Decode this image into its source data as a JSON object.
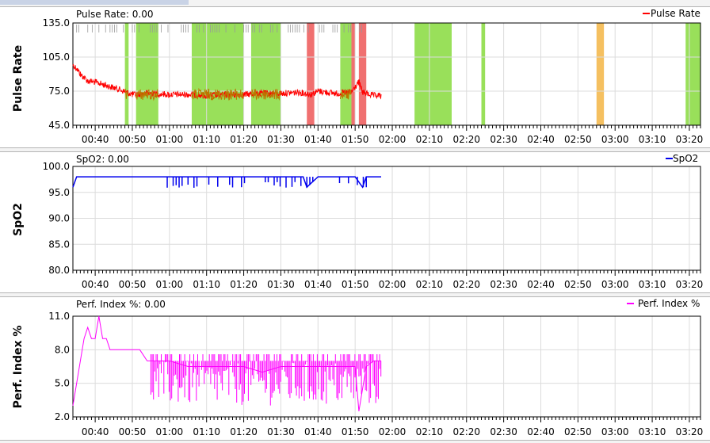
{
  "charts": [
    {
      "id": "pulse",
      "ylabel": "Pulse Rate",
      "title": "Pulse Rate: 0.00",
      "legend": "Pulse Rate",
      "color": "#ff0000",
      "overlap_color": "#bb7700",
      "yticks": [
        "135.0",
        "105.0",
        "75.0",
        "45.0"
      ]
    },
    {
      "id": "spo2",
      "ylabel": "SpO2",
      "title": "SpO2: 0.00",
      "legend": "SpO2",
      "color": "#0000ee",
      "yticks": [
        "100.0",
        "95.0",
        "90.0",
        "85.0",
        "80.0"
      ]
    },
    {
      "id": "perf",
      "ylabel": "Perf. Index %",
      "title": "Perf. Index %: 0.00",
      "legend": "Perf. Index %",
      "color": "#ff00ff",
      "yticks": [
        "11.0",
        "8.0",
        "5.0",
        "2.0"
      ]
    }
  ],
  "xticks": [
    "00:40",
    "00:50",
    "01:00",
    "01:10",
    "01:20",
    "01:30",
    "01:40",
    "01:50",
    "02:00",
    "02:10",
    "02:20",
    "02:30",
    "02:40",
    "02:50",
    "03:00",
    "03:10",
    "03:20"
  ],
  "chart_data": [
    {
      "type": "line",
      "title": "Pulse Rate: 0.00",
      "ylabel": "Pulse Rate",
      "legend": "top-right",
      "x_unit": "clock time (hh:mm)",
      "xlim": [
        "00:34",
        "03:23"
      ],
      "ylim": [
        45,
        135
      ],
      "grid": true,
      "series": [
        {
          "name": "Pulse Rate",
          "color": "#ff0000",
          "x": [
            "00:34",
            "00:35",
            "00:36",
            "00:38",
            "00:40",
            "00:43",
            "00:46",
            "00:50",
            "00:55",
            "01:00",
            "01:05",
            "01:10",
            "01:15",
            "01:20",
            "01:25",
            "01:30",
            "01:35",
            "01:38",
            "01:40",
            "01:45",
            "01:49",
            "01:51",
            "01:52",
            "01:55",
            "01:57"
          ],
          "y": [
            98,
            95,
            90,
            84,
            83,
            80,
            77,
            72,
            73,
            72,
            72,
            71,
            72,
            72,
            73,
            73,
            74,
            72,
            75,
            73,
            74,
            83,
            74,
            71,
            71
          ]
        }
      ],
      "bands": [
        {
          "start": "00:48",
          "end": "00:49",
          "color": "#99e05a"
        },
        {
          "start": "00:51",
          "end": "00:57",
          "color": "#99e05a"
        },
        {
          "start": "01:06",
          "end": "01:20",
          "color": "#99e05a"
        },
        {
          "start": "01:22",
          "end": "01:30",
          "color": "#99e05a"
        },
        {
          "start": "01:37",
          "end": "01:39",
          "color": "#f07070"
        },
        {
          "start": "01:46",
          "end": "01:49",
          "color": "#99e05a"
        },
        {
          "start": "01:49",
          "end": "01:50",
          "color": "#f07070"
        },
        {
          "start": "01:51",
          "end": "01:53",
          "color": "#f07070"
        },
        {
          "start": "02:06",
          "end": "02:16",
          "color": "#99e05a"
        },
        {
          "start": "02:24",
          "end": "02:25",
          "color": "#99e05a"
        },
        {
          "start": "02:55",
          "end": "02:57",
          "color": "#f5c060"
        },
        {
          "start": "03:19",
          "end": "03:23",
          "color": "#99e05a"
        }
      ]
    },
    {
      "type": "line",
      "title": "SpO2: 0.00",
      "ylabel": "SpO2",
      "legend": "top-right",
      "x_unit": "clock time (hh:mm)",
      "xlim": [
        "00:34",
        "03:23"
      ],
      "ylim": [
        80,
        100
      ],
      "grid": true,
      "series": [
        {
          "name": "SpO2",
          "color": "#0000ee",
          "x": [
            "00:34",
            "00:35",
            "00:40",
            "00:50",
            "01:00",
            "01:10",
            "01:20",
            "01:30",
            "01:36",
            "01:37",
            "01:40",
            "01:50",
            "01:52",
            "01:53",
            "01:57"
          ],
          "y": [
            96,
            98,
            98,
            98,
            98,
            98,
            98,
            98,
            98,
            96,
            98,
            98,
            96,
            98,
            98
          ]
        }
      ]
    },
    {
      "type": "line",
      "title": "Perf. Index %: 0.00",
      "ylabel": "Perf. Index %",
      "legend": "top-right",
      "x_unit": "clock time (hh:mm)",
      "xlim": [
        "00:34",
        "03:23"
      ],
      "ylim": [
        2,
        11
      ],
      "grid": true,
      "series": [
        {
          "name": "Perf. Index %",
          "color": "#ff00ff",
          "x": [
            "00:34",
            "00:35",
            "00:36",
            "00:37",
            "00:38",
            "00:39",
            "00:40",
            "00:41",
            "00:42",
            "00:43",
            "00:44",
            "00:46",
            "00:48",
            "00:50",
            "00:52",
            "00:54",
            "00:56",
            "00:58",
            "01:00",
            "01:05",
            "01:10",
            "01:15",
            "01:20",
            "01:25",
            "01:30",
            "01:35",
            "01:40",
            "01:45",
            "01:50",
            "01:51",
            "01:53",
            "01:55",
            "01:57"
          ],
          "y": [
            3,
            5,
            7,
            9,
            10,
            9,
            9,
            11,
            9,
            9,
            8,
            8,
            8,
            8,
            8,
            7,
            7,
            7,
            7,
            6.5,
            6.5,
            6.5,
            6.5,
            6,
            6.5,
            6.5,
            6.5,
            6.5,
            6.5,
            2.5,
            6.5,
            7,
            7
          ]
        }
      ]
    }
  ]
}
